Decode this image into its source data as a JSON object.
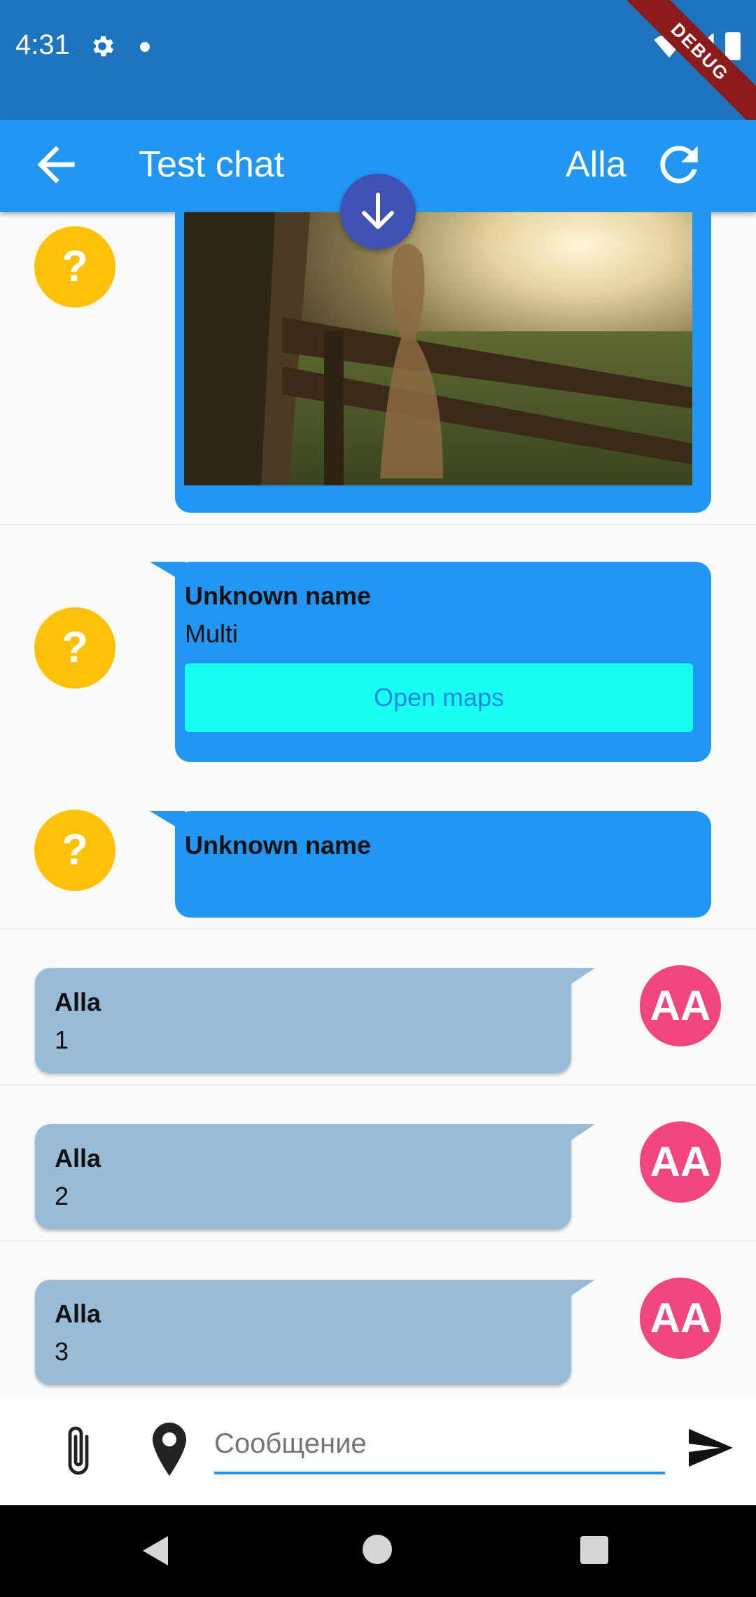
{
  "status_bar": {
    "time": "4:31",
    "debug_label": "DEBUG"
  },
  "app_bar": {
    "title": "Test chat",
    "user_name": "Alla"
  },
  "messages": [
    {
      "type": "image",
      "avatar": "?"
    },
    {
      "type": "incoming",
      "avatar": "?",
      "sender": "Unknown name",
      "text": "Multi",
      "button_label": "Open maps"
    },
    {
      "type": "incoming",
      "avatar": "?",
      "sender": "Unknown name",
      "text": ""
    },
    {
      "type": "outgoing",
      "avatar": "AA",
      "sender": "Alla",
      "text": "1"
    },
    {
      "type": "outgoing",
      "avatar": "AA",
      "sender": "Alla",
      "text": "2"
    },
    {
      "type": "outgoing",
      "avatar": "AA",
      "sender": "Alla",
      "text": "3"
    }
  ],
  "input": {
    "placeholder": "Сообщение",
    "value": ""
  },
  "icons": [
    "back-arrow-icon",
    "refresh-icon",
    "arrow-down-icon",
    "attach-icon",
    "location-pin-icon",
    "send-icon",
    "gear-icon"
  ],
  "colors": {
    "app_bar": "#2196f3",
    "status_bar": "#1e74bf",
    "incoming_bubble": "#2196f3",
    "outgoing_bubble": "#98bbd8",
    "unknown_avatar": "#ffc107",
    "user_avatar": "#f0457f",
    "fab": "#3f51b5",
    "maps_button": "#18fff2"
  }
}
